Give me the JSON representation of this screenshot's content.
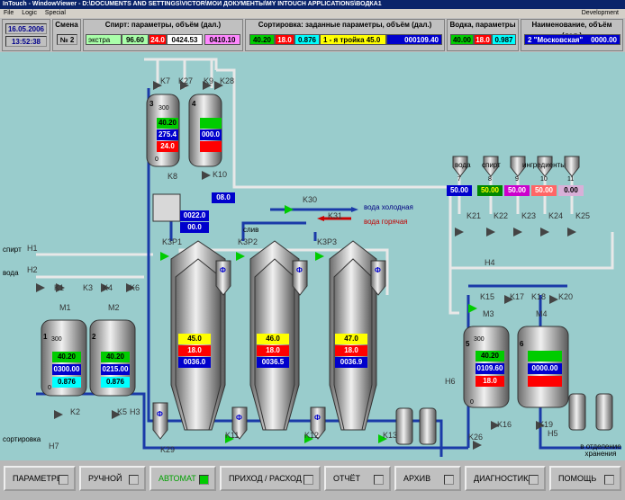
{
  "window_title": "InTouch - WindowViewer - D:\\DOCUMENTS AND SETTINGS\\VICTOR\\МОИ ДОКУМЕНТЫ\\MY INTOUCH APPLICATIONS\\ВОДКА1",
  "menu": {
    "file": "File",
    "logic": "Logic",
    "special": "Special",
    "development": "Development"
  },
  "header": {
    "date": "16.05.2006",
    "time": "13:52:38",
    "shift_label": "Смена",
    "shift_value": "№ 2",
    "spirit_title": "Спирт: параметры, объём (дал.)",
    "spirit_grade": "экстра",
    "spirit_strength": "96.60",
    "spirit_temp": "24.0",
    "spirit_volume": "0424.53",
    "spirit_extra": "0410.10",
    "sort_title": "Сортировка: заданные параметры, объём (дал.)",
    "sort_strength": "40.20",
    "sort_temp": "18.0",
    "sort_ratio": "0.876",
    "sort_name": "1 - я тройка  45.0",
    "sort_volume": "000109.40",
    "water_title": "Водка, параметры",
    "water_strength": "40.00",
    "water_temp": "18.0",
    "water_ratio": "0.987",
    "name_title": "Наименование, объём (дал.)",
    "name_value": "2  \"Московская\"",
    "name_volume": "0000.00"
  },
  "plant": {
    "labels": {
      "spirit": "спирт",
      "water": "вода",
      "sorting": "сортировка",
      "cold_water": "вода холодная",
      "hot_water": "вода горячая",
      "drain": "слив",
      "ing_water": "вода",
      "ing_spirit": "спирт",
      "ingredients": "ингредиенты",
      "to_storage": "в отделение хранения"
    },
    "valves": [
      "K7",
      "K27",
      "K9",
      "K28",
      "K10",
      "K8",
      "K30",
      "K31",
      "H1",
      "H2",
      "K1",
      "K3",
      "K4",
      "K6",
      "M1",
      "M2",
      "K2",
      "K5",
      "H3",
      "H7",
      "K29",
      "K3P1",
      "K3P2",
      "K3P3",
      "K11",
      "K12",
      "K13",
      "H6",
      "K21",
      "K22",
      "K23",
      "K24",
      "K25",
      "H4",
      "K15",
      "K17",
      "K18",
      "K20",
      "M3",
      "M4",
      "K16",
      "K19",
      "H5",
      "K26"
    ],
    "top_tank3": {
      "num": "3",
      "scale_top": "300",
      "scale_bot": "0",
      "strength": "40.20",
      "volume": "275.4",
      "temp": "24.0"
    },
    "top_tank4": {
      "num": "4",
      "volume": "000.0"
    },
    "hx": {
      "top": "08.0",
      "flow": "0022.0",
      "out": "00.0"
    },
    "tank1": {
      "num": "1",
      "scale_top": "300",
      "scale_bot": "0",
      "strength": "40.20",
      "volume": "0300.00",
      "ratio": "0.876"
    },
    "tank2": {
      "num": "2",
      "strength": "40.20",
      "volume": "0215.00",
      "ratio": "0.876"
    },
    "filter1": {
      "strength": "45.0",
      "temp": "18.0",
      "volume": "0036.0"
    },
    "filter2": {
      "strength": "46.0",
      "temp": "18.0",
      "volume": "0036.5"
    },
    "filter3": {
      "strength": "47.0",
      "temp": "18.0",
      "volume": "0036.9"
    },
    "phi": "Ф",
    "ing": [
      {
        "num": "7",
        "val": "50.00",
        "color": "#0000cc",
        "text": "#ffffff"
      },
      {
        "num": "8",
        "val": "50.00",
        "color": "#008800",
        "text": "#ffff00"
      },
      {
        "num": "9",
        "val": "50.00",
        "color": "#cc00cc",
        "text": "#ffffff"
      },
      {
        "num": "10",
        "val": "50.00",
        "color": "#ff6666",
        "text": "#ffffff"
      },
      {
        "num": "11",
        "val": "0.00",
        "color": "#d8b0d8",
        "text": "#000000"
      }
    ],
    "tank5": {
      "num": "5",
      "scale_top": "300",
      "scale_bot": "0",
      "strength": "40.20",
      "volume": "0109.60",
      "temp": "18.0"
    },
    "tank6": {
      "num": "6",
      "volume": "0000.00"
    }
  },
  "footer": {
    "buttons": [
      {
        "label": "ПАРАМЕТРЫ",
        "active": false
      },
      {
        "label": "РУЧНОЙ",
        "active": false
      },
      {
        "label": "АВТОМАТ",
        "active": true
      },
      {
        "label": "ПРИХОД / РАСХОД",
        "active": false
      },
      {
        "label": "ОТЧЁТ",
        "active": false
      },
      {
        "label": "АРХИВ",
        "active": false
      },
      {
        "label": "ДИАГНОСТИКА",
        "active": false
      },
      {
        "label": "ПОМОЩЬ",
        "active": false
      }
    ]
  },
  "colors": {
    "pipe": "#1a3aa8",
    "pipe_light": "#e8e8e8",
    "plant_bg": "#99cccc",
    "green": "#00cc00",
    "red": "#ff0000",
    "blue": "#0000cc",
    "yellow": "#ffff00",
    "cyan": "#00ffff"
  }
}
